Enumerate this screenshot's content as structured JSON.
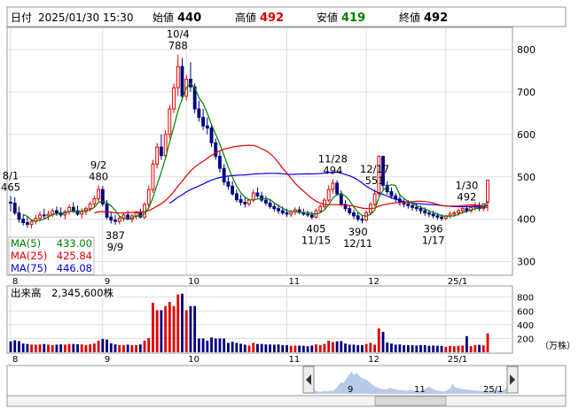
{
  "header": {
    "date_label": "日付",
    "date_value": "2025/01/30 15:30",
    "open_label": "始値",
    "open_value": "440",
    "high_label": "高値",
    "high_value": "492",
    "low_label": "安値",
    "low_value": "419",
    "close_label": "終値",
    "close_value": "492"
  },
  "colors": {
    "up": "#e00000",
    "down": "#000080",
    "ma5": "#008000",
    "ma25": "#e00000",
    "ma75": "#0000e0",
    "grid": "#dddddd",
    "navigator_fill": "#b0c4e8"
  },
  "ma_legend": [
    {
      "label": "MA(5)",
      "value": "433.00",
      "color": "#008000"
    },
    {
      "label": "MA(25)",
      "value": "425.84",
      "color": "#e00000"
    },
    {
      "label": "MA(75)",
      "value": "446.08",
      "color": "#0000e0"
    }
  ],
  "volume_legend": {
    "label": "出来高",
    "value": "2,345,600株"
  },
  "volume_unit": "（万株）",
  "navigator_labels": [
    "9",
    "11",
    "25/1"
  ],
  "chart_data": {
    "type": "candlestick",
    "x_labels": [
      "8",
      "9",
      "10",
      "11",
      "12",
      "25/1"
    ],
    "price_axis": {
      "ticks": [
        300,
        400,
        500,
        600,
        700,
        800
      ],
      "range": [
        270,
        850
      ]
    },
    "volume_axis": {
      "ticks": [
        200,
        400,
        600,
        800
      ],
      "range": [
        0,
        950
      ],
      "unit": "万株"
    },
    "annotations": [
      {
        "date": "8/1",
        "value": "465"
      },
      {
        "date": "9/2",
        "value": "480"
      },
      {
        "date": "9/9",
        "value": "387"
      },
      {
        "date": "10/4",
        "value": "788"
      },
      {
        "date": "11/15",
        "value": "405"
      },
      {
        "date": "11/28",
        "value": "494"
      },
      {
        "date": "12/11",
        "value": "390"
      },
      {
        "date": "12/17",
        "value": "551"
      },
      {
        "date": "1/17",
        "value": "396"
      },
      {
        "date": "1/30",
        "value": "492"
      }
    ],
    "candles": [
      [
        440,
        455,
        418,
        438
      ],
      [
        438,
        452,
        410,
        415
      ],
      [
        415,
        430,
        392,
        400
      ],
      [
        400,
        412,
        385,
        392
      ],
      [
        392,
        405,
        380,
        388
      ],
      [
        388,
        400,
        378,
        395
      ],
      [
        395,
        410,
        388,
        402
      ],
      [
        402,
        418,
        395,
        410
      ],
      [
        410,
        425,
        400,
        408
      ],
      [
        408,
        420,
        398,
        412
      ],
      [
        412,
        425,
        405,
        420
      ],
      [
        420,
        430,
        408,
        415
      ],
      [
        415,
        428,
        405,
        410
      ],
      [
        410,
        422,
        400,
        418
      ],
      [
        418,
        435,
        410,
        428
      ],
      [
        428,
        440,
        415,
        420
      ],
      [
        420,
        432,
        408,
        412
      ],
      [
        412,
        425,
        402,
        418
      ],
      [
        418,
        430,
        410,
        425
      ],
      [
        425,
        442,
        418,
        436
      ],
      [
        436,
        455,
        428,
        448
      ],
      [
        448,
        480,
        440,
        470
      ],
      [
        470,
        478,
        430,
        436
      ],
      [
        436,
        445,
        400,
        405
      ],
      [
        405,
        418,
        390,
        398
      ],
      [
        398,
        410,
        387,
        395
      ],
      [
        395,
        408,
        388,
        402
      ],
      [
        402,
        415,
        395,
        410
      ],
      [
        410,
        420,
        398,
        400
      ],
      [
        400,
        412,
        392,
        408
      ],
      [
        408,
        420,
        400,
        415
      ],
      [
        415,
        425,
        402,
        405
      ],
      [
        405,
        440,
        400,
        435
      ],
      [
        435,
        480,
        428,
        470
      ],
      [
        470,
        540,
        462,
        530
      ],
      [
        530,
        580,
        520,
        570
      ],
      [
        570,
        600,
        540,
        550
      ],
      [
        550,
        610,
        540,
        600
      ],
      [
        600,
        670,
        590,
        660
      ],
      [
        660,
        720,
        650,
        710
      ],
      [
        710,
        788,
        690,
        760
      ],
      [
        760,
        780,
        680,
        690
      ],
      [
        690,
        740,
        680,
        730
      ],
      [
        730,
        770,
        700,
        712
      ],
      [
        712,
        720,
        650,
        660
      ],
      [
        660,
        680,
        630,
        640
      ],
      [
        640,
        660,
        610,
        620
      ],
      [
        620,
        640,
        600,
        615
      ],
      [
        615,
        625,
        570,
        580
      ],
      [
        580,
        590,
        540,
        548
      ],
      [
        548,
        560,
        510,
        520
      ],
      [
        520,
        530,
        480,
        488
      ],
      [
        488,
        500,
        470,
        478
      ],
      [
        478,
        490,
        455,
        460
      ],
      [
        460,
        470,
        440,
        446
      ],
      [
        446,
        458,
        432,
        440
      ],
      [
        440,
        450,
        428,
        436
      ],
      [
        436,
        448,
        430,
        445
      ],
      [
        445,
        470,
        440,
        462
      ],
      [
        462,
        475,
        450,
        455
      ],
      [
        455,
        465,
        440,
        445
      ],
      [
        445,
        455,
        432,
        438
      ],
      [
        438,
        448,
        425,
        430
      ],
      [
        430,
        440,
        418,
        425
      ],
      [
        425,
        435,
        412,
        420
      ],
      [
        420,
        430,
        410,
        415
      ],
      [
        415,
        425,
        405,
        412
      ],
      [
        412,
        422,
        405,
        418
      ],
      [
        418,
        428,
        410,
        422
      ],
      [
        422,
        430,
        412,
        416
      ],
      [
        416,
        425,
        408,
        412
      ],
      [
        412,
        420,
        405,
        410
      ],
      [
        410,
        418,
        400,
        405
      ],
      [
        405,
        425,
        402,
        420
      ],
      [
        420,
        435,
        415,
        430
      ],
      [
        430,
        450,
        425,
        445
      ],
      [
        445,
        480,
        440,
        470
      ],
      [
        470,
        494,
        460,
        485
      ],
      [
        485,
        492,
        455,
        460
      ],
      [
        460,
        468,
        430,
        435
      ],
      [
        435,
        445,
        418,
        425
      ],
      [
        425,
        432,
        410,
        415
      ],
      [
        415,
        422,
        400,
        408
      ],
      [
        408,
        415,
        395,
        400
      ],
      [
        400,
        410,
        390,
        398
      ],
      [
        398,
        420,
        395,
        415
      ],
      [
        415,
        440,
        410,
        435
      ],
      [
        435,
        470,
        430,
        460
      ],
      [
        460,
        551,
        455,
        548
      ],
      [
        548,
        550,
        470,
        480
      ],
      [
        480,
        490,
        458,
        465
      ],
      [
        465,
        475,
        448,
        455
      ],
      [
        455,
        462,
        440,
        448
      ],
      [
        448,
        455,
        432,
        440
      ],
      [
        440,
        448,
        428,
        436
      ],
      [
        436,
        445,
        425,
        432
      ],
      [
        432,
        440,
        420,
        428
      ],
      [
        428,
        436,
        418,
        425
      ],
      [
        425,
        432,
        412,
        420
      ],
      [
        420,
        428,
        408,
        415
      ],
      [
        415,
        422,
        405,
        412
      ],
      [
        412,
        420,
        402,
        408
      ],
      [
        408,
        415,
        398,
        405
      ],
      [
        405,
        412,
        396,
        402
      ],
      [
        402,
        410,
        398,
        408
      ],
      [
        408,
        418,
        402,
        412
      ],
      [
        412,
        420,
        405,
        415
      ],
      [
        415,
        425,
        408,
        420
      ],
      [
        420,
        430,
        412,
        425
      ],
      [
        425,
        432,
        415,
        420
      ],
      [
        420,
        430,
        415,
        428
      ],
      [
        428,
        440,
        420,
        433
      ],
      [
        433,
        440,
        419,
        425
      ],
      [
        425,
        438,
        419,
        436
      ],
      [
        440,
        492,
        419,
        492
      ]
    ]
  }
}
